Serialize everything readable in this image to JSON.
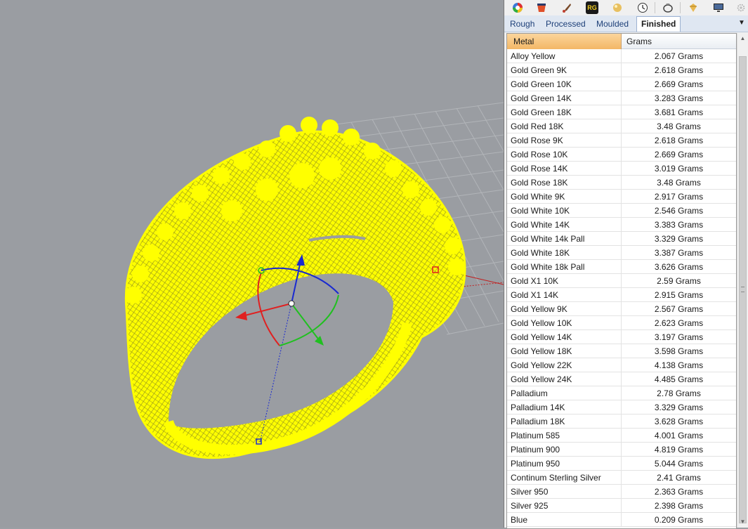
{
  "toolbar": {
    "icons": [
      "color-wheel-icon",
      "render-icon",
      "brush-icon",
      "rg-plugin-icon",
      "material-ball-icon",
      "clock-icon",
      "ring-icon",
      "gem-icon",
      "monitor-icon",
      "settings-icon"
    ],
    "rg_label": "RG"
  },
  "tabs": {
    "rough": "Rough",
    "processed": "Processed",
    "moulded": "Moulded",
    "finished": "Finished"
  },
  "table": {
    "headers": {
      "metal": "Metal",
      "grams": "Grams"
    },
    "rows": [
      {
        "metal": "Alloy Yellow",
        "grams": "2.067 Grams"
      },
      {
        "metal": "Gold Green 9K",
        "grams": "2.618 Grams"
      },
      {
        "metal": "Gold Green 10K",
        "grams": "2.669 Grams"
      },
      {
        "metal": "Gold Green 14K",
        "grams": "3.283 Grams"
      },
      {
        "metal": "Gold Green 18K",
        "grams": "3.681 Grams"
      },
      {
        "metal": "Gold Red 18K",
        "grams": "3.48 Grams"
      },
      {
        "metal": "Gold Rose 9K",
        "grams": "2.618 Grams"
      },
      {
        "metal": "Gold Rose 10K",
        "grams": "2.669 Grams"
      },
      {
        "metal": "Gold Rose 14K",
        "grams": "3.019 Grams"
      },
      {
        "metal": "Gold Rose 18K",
        "grams": "3.48 Grams"
      },
      {
        "metal": "Gold White 9K",
        "grams": "2.917 Grams"
      },
      {
        "metal": "Gold White 10K",
        "grams": "2.546 Grams"
      },
      {
        "metal": "Gold White 14K",
        "grams": "3.383 Grams"
      },
      {
        "metal": "Gold White 14k Pall",
        "grams": "3.329 Grams"
      },
      {
        "metal": "Gold White 18K",
        "grams": "3.387 Grams"
      },
      {
        "metal": "Gold White 18k Pall",
        "grams": "3.626 Grams"
      },
      {
        "metal": "Gold X1 10K",
        "grams": "2.59 Grams"
      },
      {
        "metal": "Gold X1 14K",
        "grams": "2.915 Grams"
      },
      {
        "metal": "Gold Yellow 9K",
        "grams": "2.567 Grams"
      },
      {
        "metal": "Gold Yellow 10K",
        "grams": "2.623 Grams"
      },
      {
        "metal": "Gold Yellow 14K",
        "grams": "3.197 Grams"
      },
      {
        "metal": "Gold Yellow 18K",
        "grams": "3.598 Grams"
      },
      {
        "metal": "Gold Yellow 22K",
        "grams": "4.138 Grams"
      },
      {
        "metal": "Gold Yellow 24K",
        "grams": "4.485 Grams"
      },
      {
        "metal": "Palladium",
        "grams": "2.78 Grams"
      },
      {
        "metal": "Palladium 14K",
        "grams": "3.329 Grams"
      },
      {
        "metal": "Palladium 18K",
        "grams": "3.628 Grams"
      },
      {
        "metal": "Platinum 585",
        "grams": "4.001 Grams"
      },
      {
        "metal": "Platinum 900",
        "grams": "4.819 Grams"
      },
      {
        "metal": "Platinum 950",
        "grams": "5.044 Grams"
      },
      {
        "metal": "Continum Sterling Silver",
        "grams": "2.41 Grams"
      },
      {
        "metal": "Silver 950",
        "grams": "2.363 Grams"
      },
      {
        "metal": "Silver 925",
        "grams": "2.398 Grams"
      },
      {
        "metal": "Blue",
        "grams": "0.209 Grams"
      }
    ]
  },
  "colors": {
    "viewport_bg": "#9a9da2",
    "mesh": "#ffff00",
    "header_active": "#f5bf74",
    "gumball_x": "#e02020",
    "gumball_y": "#20c020",
    "gumball_z": "#1a2ad0"
  }
}
